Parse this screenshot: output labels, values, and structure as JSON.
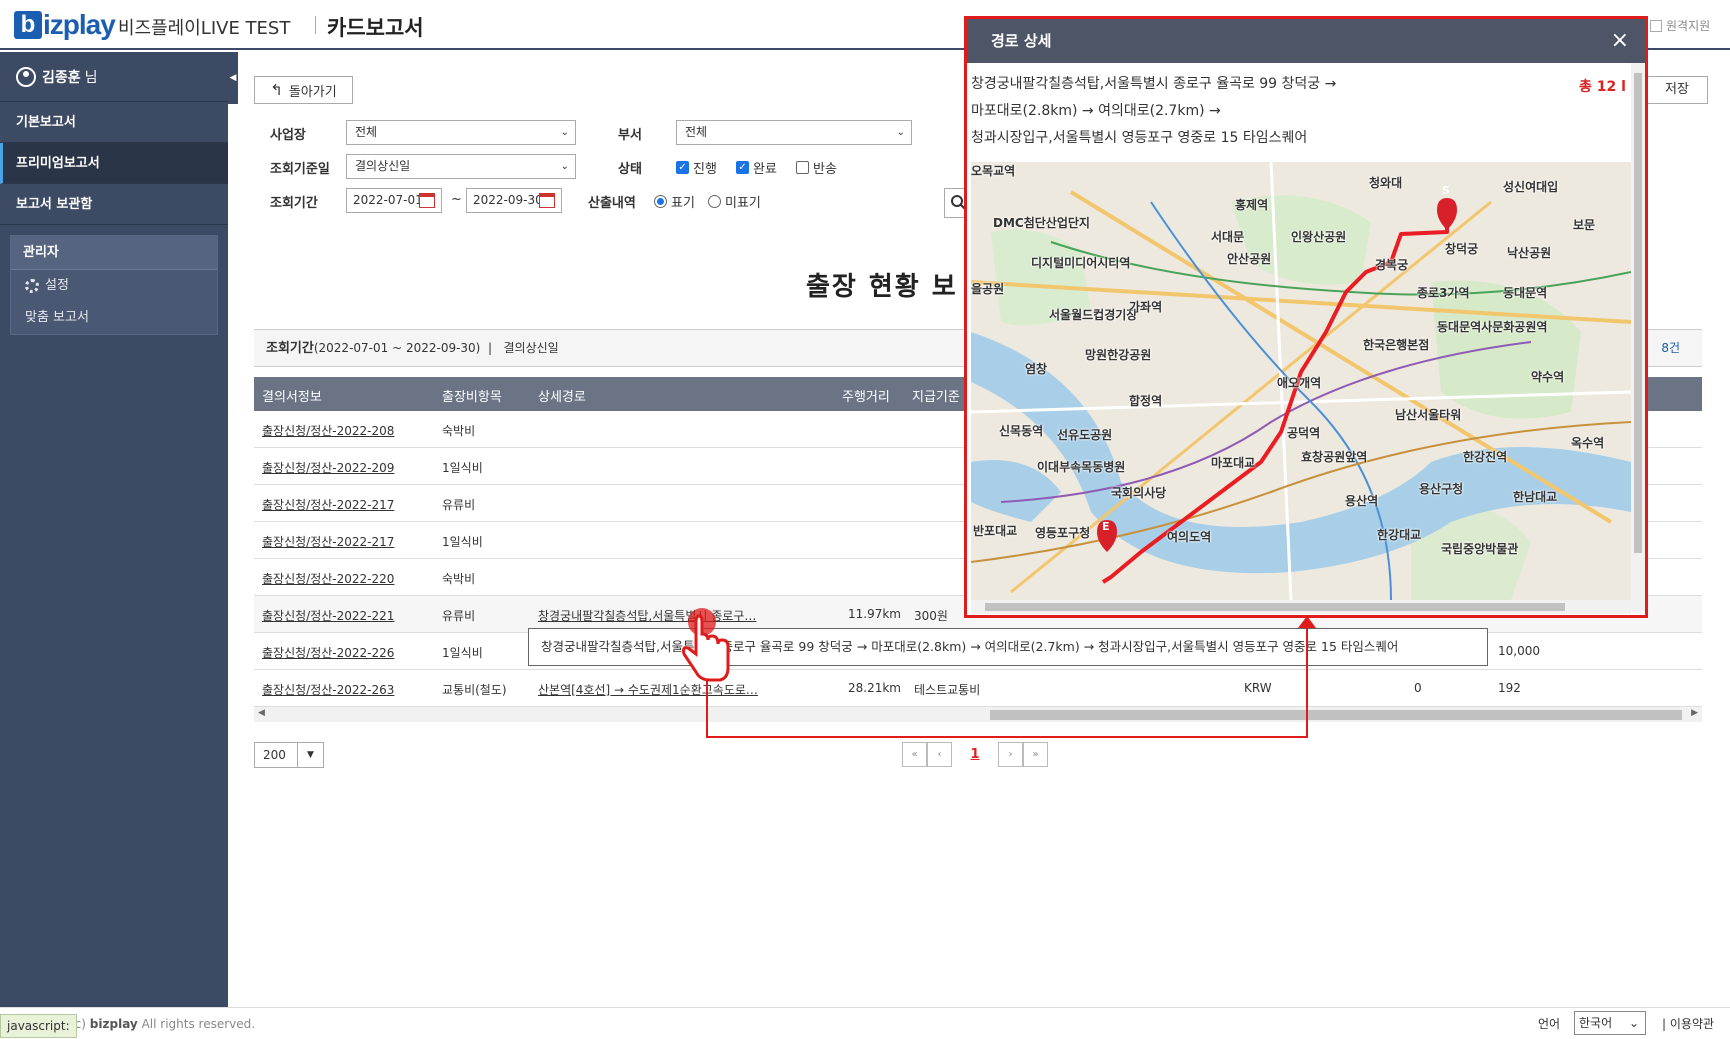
{
  "topbar": {
    "brand_letter": "b",
    "brand_text": "izplay",
    "app_name": "비즈플레이LIVE TEST",
    "page_title": "카드보고서",
    "remote_support": "원격지원"
  },
  "sidebar": {
    "user_name": "김종훈",
    "user_suffix": "님",
    "items": [
      {
        "label": "기본보고서"
      },
      {
        "label": "프리미엄보고서"
      },
      {
        "label": "보고서 보관함"
      }
    ],
    "admin_title": "관리자",
    "admin_items": [
      {
        "label": "설정"
      },
      {
        "label": "맞춤 보고서"
      }
    ]
  },
  "toolbar": {
    "back_label": "돌아가기",
    "save_label": "저장"
  },
  "filters": {
    "site_label": "사업장",
    "site_value": "전체",
    "dept_label": "부서",
    "dept_value": "전체",
    "date_basis_label": "조회기준일",
    "date_basis_value": "결의상신일",
    "period_label": "조회기간",
    "date_from": "2022-07-01",
    "date_sep": "~",
    "date_to": "2022-09-30",
    "status_label": "상태",
    "status_options": [
      "진행",
      "완료",
      "반송"
    ],
    "output_label": "산출내역",
    "output_options": [
      "표기",
      "미표기"
    ]
  },
  "report": {
    "title": "출장 현황 보",
    "summary_label": "조회기간",
    "summary_period": "(2022-07-01 ~ 2022-09-30)",
    "summary_sep": "|",
    "summary_basis": "결의상신일",
    "count": "8건"
  },
  "table": {
    "headers": [
      "결의서정보",
      "출장비항목",
      "상세경로",
      "주행거리",
      "지급기준"
    ],
    "rows": [
      {
        "doc": "출장신청/정산-2022-208",
        "item": "숙박비"
      },
      {
        "doc": "출장신청/정산-2022-209",
        "item": "1일식비"
      },
      {
        "doc": "출장신청/정산-2022-217",
        "item": "유류비"
      },
      {
        "doc": "출장신청/정산-2022-217",
        "item": "1일식비"
      },
      {
        "doc": "출장신청/정산-2022-220",
        "item": "숙박비"
      },
      {
        "doc": "출장신청/정산-2022-221",
        "item": "유류비",
        "route": "창경궁내팔각칠층석탑,서울특별시 종로구…",
        "distance": "11.97km",
        "basis": "300원"
      },
      {
        "doc": "출장신청/정산-2022-226",
        "item": "1일식비",
        "amount": "10,000"
      },
      {
        "doc": "출장신청/정산-2022-263",
        "item": "교통비(철도)",
        "route": "산본역[4호선] → 수도권제1순환고속도로…",
        "distance": "28.21km",
        "basis": "테스트교통비",
        "currency": "KRW",
        "zero": "0",
        "amount": "192"
      }
    ],
    "tooltip": "창경궁내팔각칠층석탑,서울특별시 종로구 율곡로 99 창덕궁 → 마포대로(2.8km) → 여의대로(2.7km) → 청과시장입구,서울특별시 영등포구 영중로 15 타임스퀘어"
  },
  "pagination": {
    "page_size": "200",
    "current_page": "1"
  },
  "popup": {
    "title": "경로 상세",
    "route_lines": [
      "창경궁내팔각칠층석탑,서울특별시 종로구 율곡로 99 창덕궁 →",
      "마포대로(2.8km) → 여의대로(2.7km) →",
      "청과시장입구,서울특별시 영등포구 영중로 15 타임스퀘어"
    ],
    "total": "총 12 l",
    "map": {
      "start_marker": "S",
      "end_marker": "E",
      "places": [
        "청와대",
        "홍제역",
        "성신여대입",
        "DMC첨단산업단지",
        "인왕산공원",
        "보문",
        "서대문",
        "창덕궁",
        "낙산공원",
        "안산공원",
        "경복궁",
        "디지털미디어시티역",
        "종로3가역",
        "동대문역",
        "을공원",
        "동대문역사문화공원역",
        "서울월드컵경기장",
        "가좌역",
        "한국은행본점",
        "망원한강공원",
        "약수역",
        "염창",
        "합정역",
        "애오개역",
        "남산서울타워",
        "신목동역",
        "선유도공원",
        "공덕역",
        "옥수역",
        "효창공원앞역",
        "한강진역",
        "이대부속목동병원",
        "마포대교",
        "국회의사당",
        "용산구청",
        "용산역",
        "한남대교",
        "영등포구청",
        "여의도역",
        "한강대교",
        "국립중앙박물관",
        "반포대교",
        "오목교역"
      ]
    }
  },
  "footer": {
    "copyright_prefix": "(c)",
    "copyright_brand": "bizplay",
    "copyright_rest": "All rights reserved.",
    "lang_label": "언어",
    "lang_value": "한국어",
    "terms": "| 이용약관",
    "status_text": "javascript:"
  },
  "colors": {
    "brand": "#1b5db0",
    "sidebar": "#3d4a63",
    "highlight_border": "#e01b1b",
    "table_header": "#6a7485"
  }
}
